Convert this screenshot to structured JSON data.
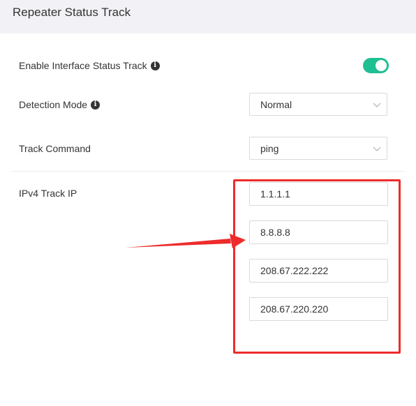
{
  "header": {
    "title": "Repeater Status Track"
  },
  "settings": {
    "enable_label": "Enable Interface Status Track",
    "enable_on": true,
    "detection_label": "Detection Mode",
    "detection_value": "Normal",
    "track_command_label": "Track Command",
    "track_command_value": "ping",
    "ipv4_label": "IPv4 Track IP",
    "ipv4_ips": [
      "1.1.1.1",
      "8.8.8.8",
      "208.67.222.222",
      "208.67.220.220"
    ]
  },
  "colors": {
    "toggle_on": "#1fbf92",
    "annotation_red": "#ee2b2b"
  },
  "icons": {
    "info": "info-icon",
    "chevron": "chevron-down-icon"
  }
}
